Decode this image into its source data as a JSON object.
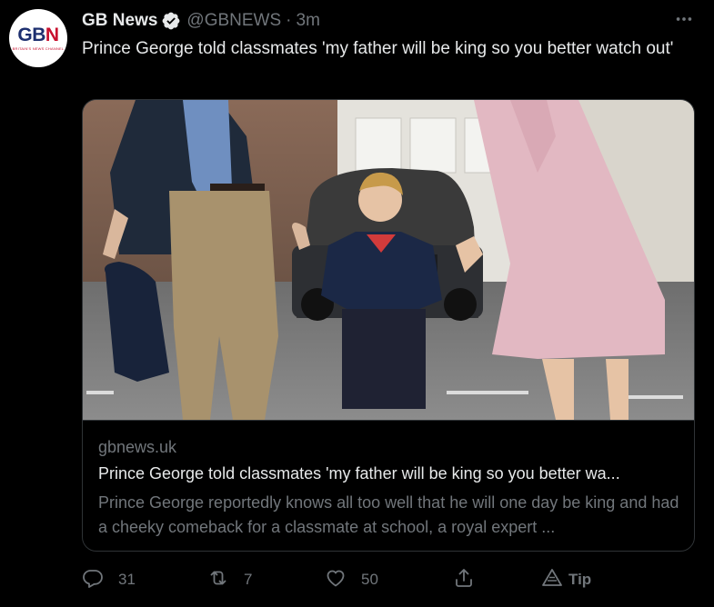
{
  "tweet": {
    "author_name": "GB News",
    "handle": "@GBNEWS",
    "separator": "·",
    "time": "3m",
    "text": "Prince George told classmates 'my father will be king so you better watch out'",
    "avatar": {
      "logo_text_a": "GB",
      "logo_text_b": "N",
      "tagline": "BRITAIN'S NEWS CHANNEL"
    }
  },
  "card": {
    "domain": "gbnews.uk",
    "title": "Prince George told classmates 'my father will be king so you better wa...",
    "description": "Prince George reportedly knows all too well that he will one day be king and had a cheeky comeback for a classmate at school, a royal expert ..."
  },
  "actions": {
    "reply_count": "31",
    "retweet_count": "7",
    "like_count": "50",
    "tip_label": "Tip"
  },
  "colors": {
    "background": "#000000",
    "text_primary": "#e7e9ea",
    "text_secondary": "#71767b",
    "border": "#2f3336",
    "verified": "#e7e9ea"
  },
  "icons": {
    "more": "more-icon",
    "verified": "verified-badge-icon",
    "reply": "reply-icon",
    "retweet": "retweet-icon",
    "like": "heart-icon",
    "share": "share-icon",
    "tip": "tip-icon"
  }
}
